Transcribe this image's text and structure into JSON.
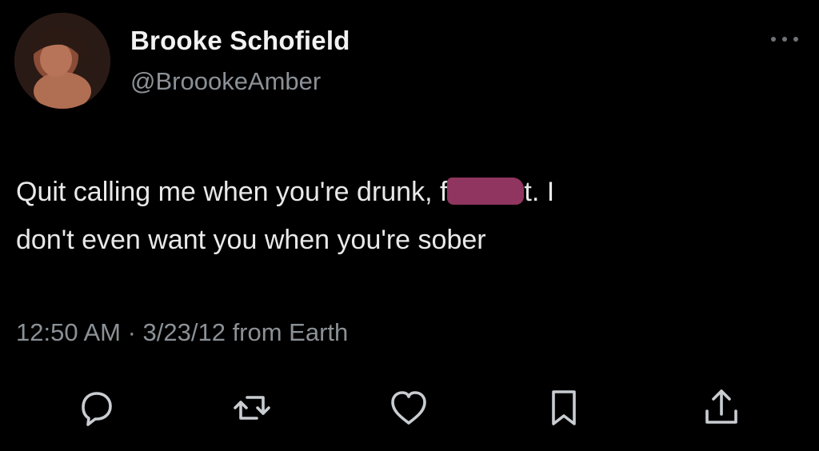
{
  "tweet": {
    "author": {
      "name": "Brooke Schofield",
      "handle": "@BroookeAmber"
    },
    "text": {
      "line1_before": "Quit calling me when you're drunk, f",
      "line1_after": "t. I",
      "line2": "don't even want you when you're sober"
    },
    "meta": "12:50 AM · 3/23/12 from Earth"
  },
  "icons": {
    "more": "more-horizontal-icon",
    "reply": "reply-icon",
    "retweet": "retweet-icon",
    "like": "heart-icon",
    "bookmark": "bookmark-icon",
    "share": "share-icon"
  },
  "colors": {
    "background": "#000000",
    "text": "#e9e9e9",
    "secondary": "#8b9196",
    "censor": "#9c3a67"
  }
}
